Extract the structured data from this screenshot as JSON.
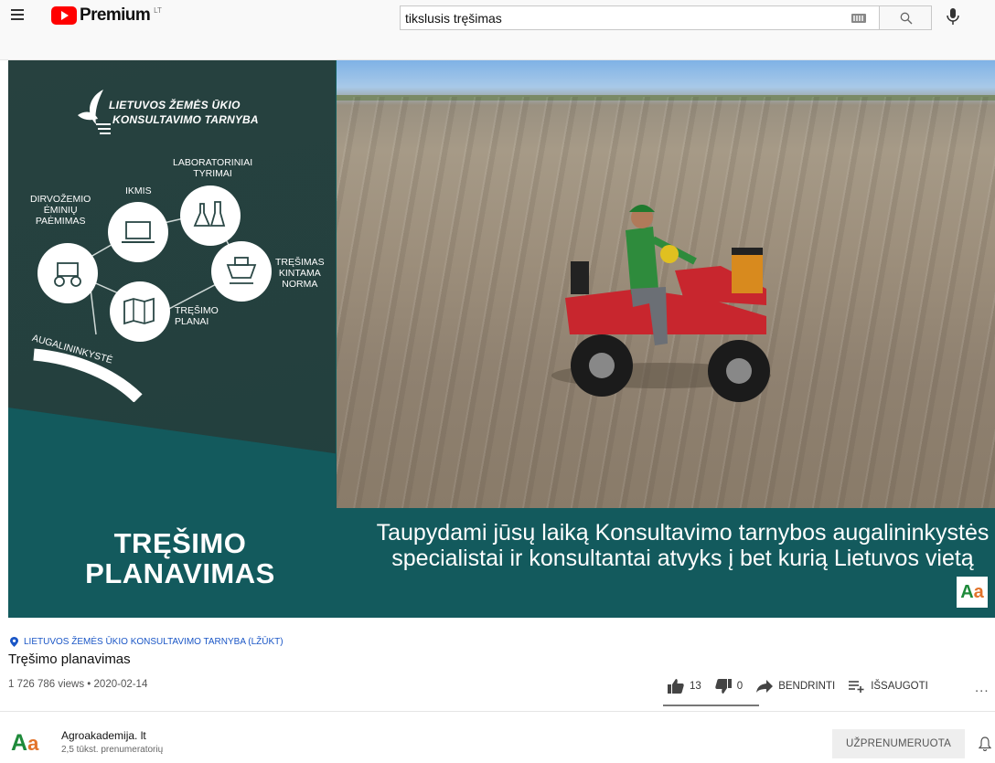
{
  "header": {
    "logo_text": "Premium",
    "region": "LT",
    "search_value": "tikslusis tręšimas"
  },
  "video": {
    "org_name_line1": "LIETUVOS ŽEMĖS ŪKIO",
    "org_name_line2": "KONSULTAVIMO TARNYBA",
    "labels": {
      "laboratoriniai": "LABORATORINIAI\nTYRIMAI",
      "ikmis": "IKMIS",
      "dirvozemio": "DIRVOŽEMIO\nĖMINIŲ\nPAĖMIMAS",
      "tresimas_kintama": "TRĘŠIMAS\nKINTAMA\nNORMA",
      "tresimo_planai": "TRĘŠIMO\nPLANAI",
      "augalininkyste": "AUGALININKYSTĖ"
    },
    "big_title": "TRĘŠIMO PLANAVIMAS",
    "subtitle": "Taupydami jūsų laiką Konsultavimo tarnybos augalininkystės specialistai ir konsultantai atvyks į bet kurią Lietuvos vietą",
    "badge_A": "A",
    "badge_a": "a"
  },
  "info": {
    "channel_tag": "LIETUVOS ŽEMĖS ŪKIO KONSULTAVIMO TARNYBA (LŽŪKT)",
    "title": "Tręšimo planavimas",
    "views_date": "1 726 786 views • 2020-02-14",
    "likes": "13",
    "dislikes": "0",
    "share_label": "BENDRINTI",
    "save_label": "IŠSAUGOTI",
    "more": "..."
  },
  "channel": {
    "avatar_A": "A",
    "avatar_a": "a",
    "name": "Agroakademija. lt",
    "subscribers": "2,5 tūkst. prenumeratorių",
    "subscribe_label": "UŽPRENUMERUOTA"
  },
  "colors": {
    "brand_red": "#ff0000",
    "video_teal": "#135a5d",
    "panel_dark": "#21403e",
    "link_blue": "#1a56c6"
  }
}
